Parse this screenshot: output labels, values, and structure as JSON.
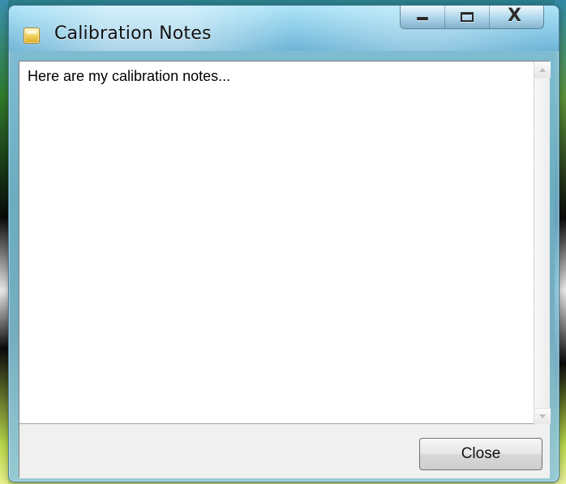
{
  "window": {
    "title": "Calibration Notes"
  },
  "editor": {
    "text": "Here are my calibration notes..."
  },
  "footer": {
    "close_label": "Close"
  },
  "caption_buttons": {
    "close_glyph": "X"
  },
  "icons": {
    "window": "notes-icon",
    "minimize": "minimize-icon",
    "maximize": "maximize-icon",
    "close": "close-icon",
    "scroll_up": "chevron-up-icon",
    "scroll_down": "chevron-down-icon"
  }
}
